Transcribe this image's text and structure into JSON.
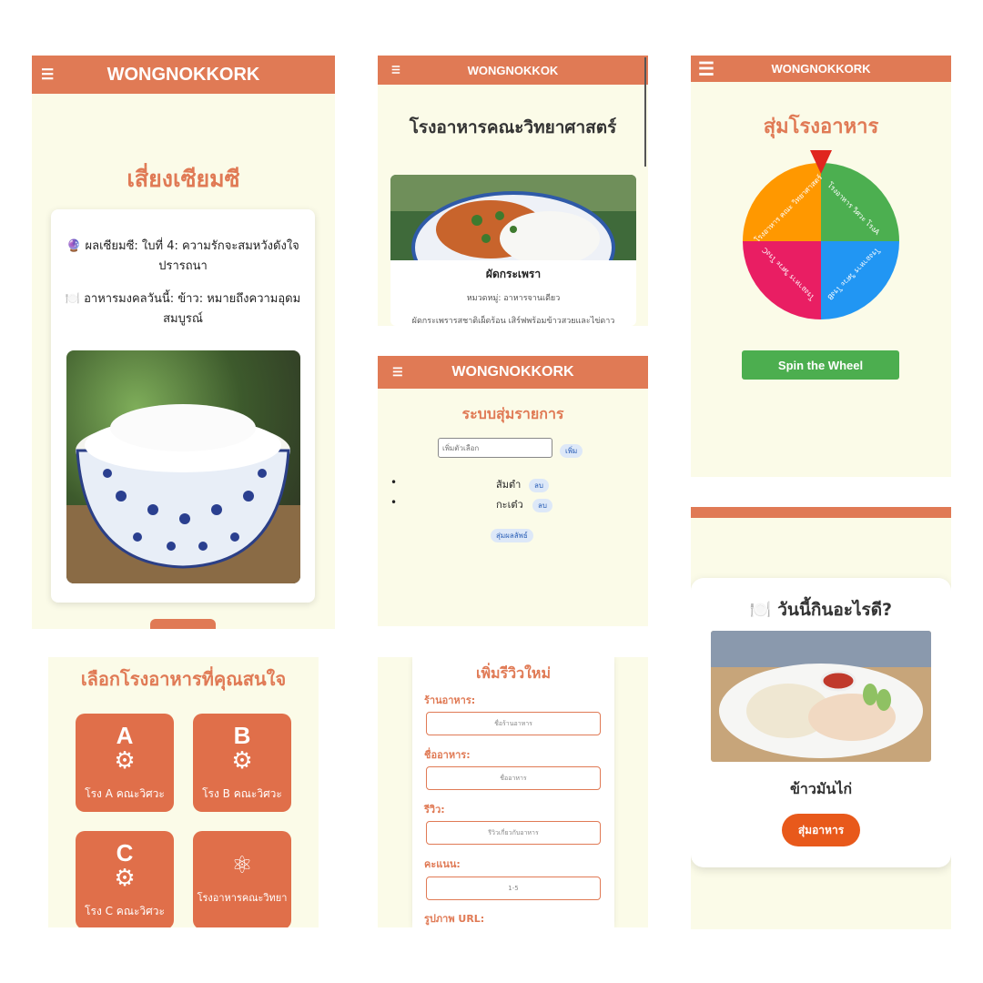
{
  "panel_fortune": {
    "menu_icon": "☰",
    "app_title": "WONGNOKKORK",
    "title": "เสี่ยงเซียมซี",
    "result_icon": "🔮",
    "result_text": "ผลเซียมซี: ใบที่ 4: ความรักจะสมหวังดังใจปรารถนา",
    "food_icon": "🍽️",
    "food_text": "อาหารมงคลวันนี้: ข้าว: หมายถึงความอุดมสมบูรณ์",
    "photo": "rice-bowl-photo"
  },
  "panel_canteen": {
    "menu_icon": "☰",
    "app_title": "WONGNOKKOK",
    "title": "โรงอาหารคณะวิทยาศาสตร์",
    "dish_name": "ผัดกระเพรา",
    "category": "หมวดหมู่: อาหารจานเดียว",
    "description": "ผัดกระเพรารสชาติเผ็ดร้อน เสิร์ฟพร้อมข้าวสวยและไข่ดาว"
  },
  "panel_wheel": {
    "menu_icon": "☰",
    "app_title": "WONGNOKKORK",
    "title": "สุ่มโรงอาหาร",
    "segments": [
      {
        "label": "โรงอาหาร วิศวะ โรงA",
        "color": "#4caf50"
      },
      {
        "label": "โรงอาหาร วิศวะ โรงB",
        "color": "#2196f3"
      },
      {
        "label": "โรงอาหาร วิศวะ โรงC",
        "color": "#e91e63"
      },
      {
        "label": "โรงอาหาร คณะ วิทยาศาสตร์",
        "color": "#ff9800"
      }
    ],
    "spin_button": "Spin the Wheel"
  },
  "panel_random_list": {
    "menu_icon": "☰",
    "app_title": "WONGNOKKORK",
    "title": "ระบบสุ่มรายการ",
    "input_placeholder": "เพิ่มตัวเลือก",
    "add_button": "เพิ่ม",
    "items": [
      {
        "label": "ส้มตำ",
        "delete": "ลบ"
      },
      {
        "label": "กะเต๋ว",
        "delete": "ลบ"
      }
    ],
    "random_button": "สุ่มผลลัพธ์"
  },
  "panel_select": {
    "title": "เลือกโรงอาหารที่คุณสนใจ",
    "tiles": [
      {
        "letter": "A",
        "label": "โรง A คณะวิศวะ"
      },
      {
        "letter": "B",
        "label": "โรง B คณะวิศวะ"
      },
      {
        "letter": "C",
        "label": "โรง C คณะวิศวะ"
      },
      {
        "letter": "",
        "label": "โรงอาหารคณะวิทยา"
      }
    ]
  },
  "panel_review": {
    "title": "เพิ่มรีวิวใหม่",
    "fields": [
      {
        "label": "ร้านอาหาร:",
        "placeholder": "ชื่อร้านอาหาร"
      },
      {
        "label": "ชื่ออาหาร:",
        "placeholder": "ชื่ออาหาร"
      },
      {
        "label": "รีวิว:",
        "placeholder": "รีวิวเกี่ยวกับอาหาร"
      },
      {
        "label": "คะแนน:",
        "placeholder": "1-5"
      }
    ],
    "image_label": "รูปภาพ URL:"
  },
  "panel_today": {
    "icon": "🍽️",
    "title": "วันนี้กินอะไรดี?",
    "dish": "ข้าวมันไก่",
    "button": "สุ่มอาหาร"
  }
}
